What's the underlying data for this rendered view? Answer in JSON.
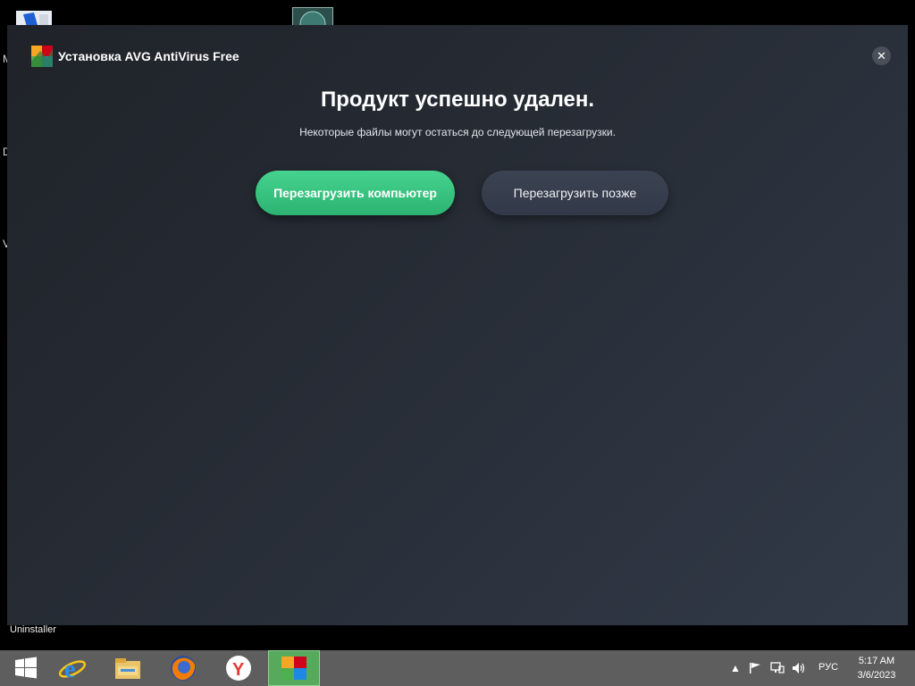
{
  "dialog": {
    "title": "Установка AVG AntiVirus Free",
    "headline": "Продукт успешно удален.",
    "subtext": "Некоторые файлы могут остаться до следующей перезагрузки.",
    "restart_now_label": "Перезагрузить компьютер",
    "restart_later_label": "Перезагрузить позже",
    "close_icon": "close-icon"
  },
  "desktop": {
    "bottom_label": "Uninstaller",
    "edge_letters": [
      "M",
      "D",
      "V"
    ]
  },
  "taskbar": {
    "items": [
      "start-icon",
      "internet-explorer-icon",
      "file-explorer-icon",
      "firefox-icon",
      "yandex-browser-icon",
      "avg-icon"
    ],
    "active_item": "avg-icon",
    "language": "РУС",
    "time": "5:17 AM",
    "date": "3/6/2023"
  },
  "colors": {
    "primary_button": "#34c07e",
    "dialog_bg": "#262b34",
    "taskbar": "#5e5e5e"
  }
}
